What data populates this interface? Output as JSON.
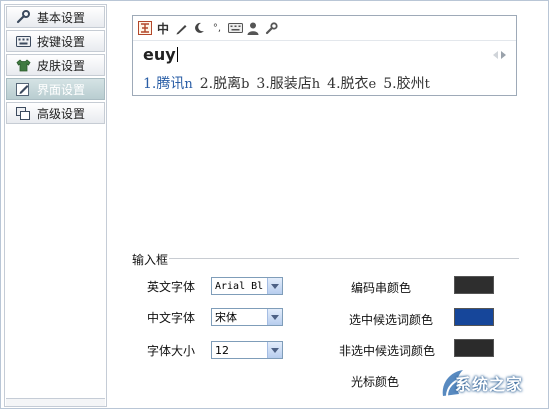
{
  "sidebar": {
    "items": [
      {
        "label": "基本设置",
        "icon": "wrench-icon"
      },
      {
        "label": "按键设置",
        "icon": "keyboard-icon"
      },
      {
        "label": "皮肤设置",
        "icon": "tshirt-icon"
      },
      {
        "label": "界面设置",
        "icon": "edit-icon",
        "active": true
      },
      {
        "label": "高级设置",
        "icon": "windows-icon"
      }
    ]
  },
  "preview": {
    "toolbar_icons": [
      "logo-icon",
      "chinese-mode-icon",
      "pen-icon",
      "moon-icon",
      "punctuation-icon",
      "keyboard-icon",
      "user-icon",
      "wrench-icon"
    ],
    "chinese_mode": "中",
    "punctuation": "°,",
    "composition": "euy",
    "candidates": [
      {
        "index": "1.",
        "word": "腾讯",
        "code": "n"
      },
      {
        "index": "2.",
        "word": "脱离",
        "code": "b"
      },
      {
        "index": "3.",
        "word": "服装店",
        "code": "h"
      },
      {
        "index": "4.",
        "word": "脱衣",
        "code": "e"
      },
      {
        "index": "5.",
        "word": "胶州",
        "code": "t"
      }
    ]
  },
  "input_box": {
    "title": "输入框",
    "english_font_label": "英文字体",
    "english_font_value": "Arial Bl",
    "chinese_font_label": "中文字体",
    "chinese_font_value": "宋体",
    "font_size_label": "字体大小",
    "font_size_value": "12",
    "code_color_label": "编码串颜色",
    "selected_color_label": "选中候选词颜色",
    "unselected_color_label": "非选中候选词颜色",
    "cursor_color_label": "光标颜色",
    "colors": {
      "code": "#2e2e2e",
      "selected": "#16469a",
      "unselected": "#2b2b2b"
    }
  },
  "watermark": {
    "text": "系统之家"
  }
}
